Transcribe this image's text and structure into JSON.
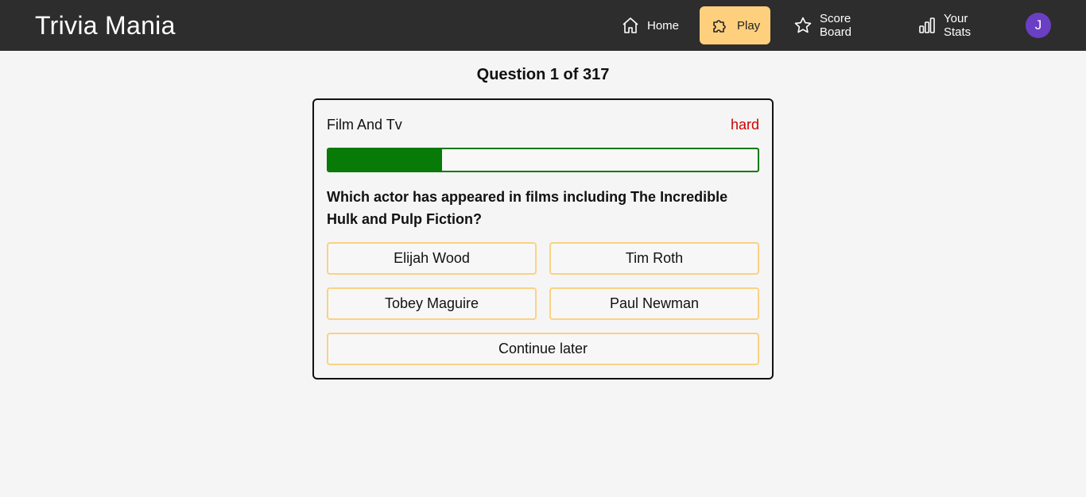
{
  "app": {
    "brand": "Trivia Mania"
  },
  "nav": {
    "items": [
      {
        "label": "Home",
        "icon": "home-icon",
        "active": false
      },
      {
        "label": "Play",
        "icon": "puzzle-icon",
        "active": true
      },
      {
        "label": "Score Board",
        "icon": "star-icon",
        "active": false
      },
      {
        "label": "Your Stats",
        "icon": "bar-chart-icon",
        "active": false
      }
    ],
    "avatar_initial": "J"
  },
  "quiz": {
    "counter": "Question 1 of 317",
    "category": "Film And Tv",
    "difficulty": "hard",
    "timer_remaining_fraction": 0.265,
    "question": "Which actor has appeared in films including The Incredible Hulk and Pulp Fiction?",
    "answers": [
      "Elijah Wood",
      "Tim Roth",
      "Tobey Maguire",
      "Paul Newman"
    ],
    "continue_label": "Continue later"
  },
  "colors": {
    "navbar": "#2d2d2d",
    "active_nav": "#fed07e",
    "avatar": "#6b3fc4",
    "difficulty_hard": "#d00000",
    "progress": "#087a08",
    "answer_border": "#fbd184"
  }
}
